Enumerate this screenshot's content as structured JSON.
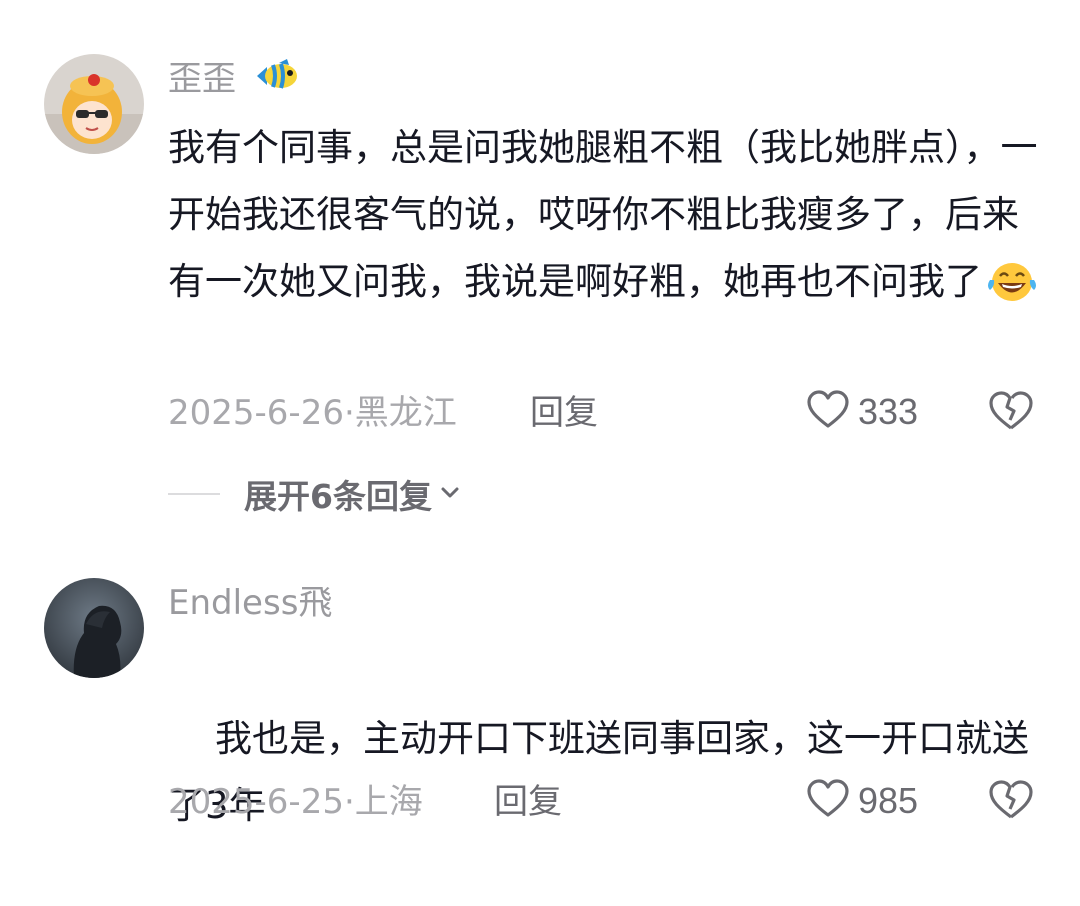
{
  "comments": [
    {
      "username": "歪歪",
      "username_badge": "fish-emoji-icon",
      "text": "我有个同事，总是问我她腿粗不粗（我比她胖点），一开始我还很客气的说，哎呀你不粗比我瘦多了，后来有一次她又问我，我说是啊好粗，她再也不问我了",
      "trailing_emoji": "laughing-tears-emoji-icon",
      "date": "2025-6-26",
      "location": "黑龙江",
      "meta_separator": "·",
      "reply_label": "回复",
      "likes": "333",
      "expand_label": "展开6条回复"
    },
    {
      "username": "Endless飛",
      "text": "我也是，主动开口下班送同事回家，这一开口就送了3年",
      "date": "2025-6-25",
      "location": "上海",
      "meta_separator": "·",
      "reply_label": "回复",
      "likes": "985"
    }
  ],
  "colors": {
    "username": "#9a9a9e",
    "body_text": "#161823",
    "meta": "#a8a8ac",
    "action": "#6a6a70"
  }
}
